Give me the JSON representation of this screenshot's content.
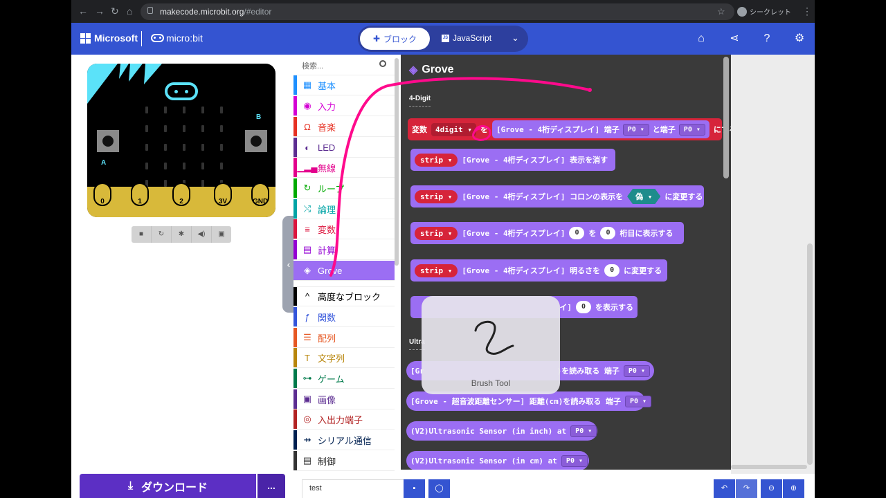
{
  "browser": {
    "url_host": "makecode.microbit.org",
    "url_path": "/#editor",
    "profile_label": "シークレット"
  },
  "header": {
    "brand": "Microsoft",
    "product": "micro:bit",
    "tab_blocks": "ブロック",
    "tab_js": "JavaScript",
    "accent_color": "#3454d1"
  },
  "simulator": {
    "button_a": "A",
    "button_b": "B",
    "pins": [
      "0",
      "1",
      "2",
      "3V",
      "GND"
    ]
  },
  "toolbox": {
    "search_placeholder": "検索...",
    "categories": [
      {
        "label": "基本",
        "color": "#1e90ff"
      },
      {
        "label": "入力",
        "color": "#d400d4"
      },
      {
        "label": "音楽",
        "color": "#e63022"
      },
      {
        "label": "LED",
        "color": "#5c2d91"
      },
      {
        "label": "無線",
        "color": "#e3008c"
      },
      {
        "label": "ループ",
        "color": "#00aa00"
      },
      {
        "label": "論理",
        "color": "#00a4a6"
      },
      {
        "label": "変数",
        "color": "#dc143c"
      },
      {
        "label": "計算",
        "color": "#9400d3"
      },
      {
        "label": "Grove",
        "color": "#9b6ef3"
      },
      {
        "label": "高度なブロック",
        "color": "#000000"
      },
      {
        "label": "関数",
        "color": "#3455db"
      },
      {
        "label": "配列",
        "color": "#e65722"
      },
      {
        "label": "文字列",
        "color": "#b8860b"
      },
      {
        "label": "ゲーム",
        "color": "#007a4b"
      },
      {
        "label": "画像",
        "color": "#5c2d91"
      },
      {
        "label": "入出力端子",
        "color": "#b22222"
      },
      {
        "label": "シリアル通信",
        "color": "#002050"
      },
      {
        "label": "制御",
        "color": "#333333"
      }
    ]
  },
  "flyout": {
    "title": "Grove",
    "section1": "4-Digit",
    "section2": "Ultra",
    "b1": {
      "kw": "変数",
      "var": "4digit",
      "op": "を",
      "text": "[Grove - 4桁ディスプレイ] 端子",
      "pin1": "P0",
      "mid": "と端子",
      "pin2": "P0",
      "end": "にする"
    },
    "b2": {
      "var": "strip",
      "text": "[Grove - 4桁ディスプレイ] 表示を消す"
    },
    "b3": {
      "var": "strip",
      "text": "[Grove - 4桁ディスプレイ] コロンの表示を",
      "bool": "偽",
      "end": "に変更する"
    },
    "b4": {
      "var": "strip",
      "text": "[Grove - 4桁ディスプレイ]",
      "n1": "0",
      "mid": "を",
      "n2": "0",
      "end": "桁目に表示する"
    },
    "b5": {
      "var": "strip",
      "text": "[Grove - 4桁ディスプレイ] 明るさを",
      "n1": "0",
      "end": "に変更する"
    },
    "b6": {
      "text": "イ]",
      "n1": "0",
      "end": "を表示する"
    },
    "b7": {
      "pre": "[Gr",
      "text": ")を読み取る 端子",
      "pin": "P0"
    },
    "b8": {
      "text": "[Grove - 超音波距離センサー] 距離(cm)を読み取る 端子",
      "pin": "P0"
    },
    "b9": {
      "text": "(V2)Ultrasonic Sensor (in inch) at",
      "pin": "P0"
    },
    "b10": {
      "text": "(V2)Ultrasonic Sensor (in cm) at",
      "pin": "P0"
    }
  },
  "overlay": {
    "label": "Brush Tool"
  },
  "footer": {
    "download": "ダウンロード",
    "more": "...",
    "project_name": "test"
  }
}
